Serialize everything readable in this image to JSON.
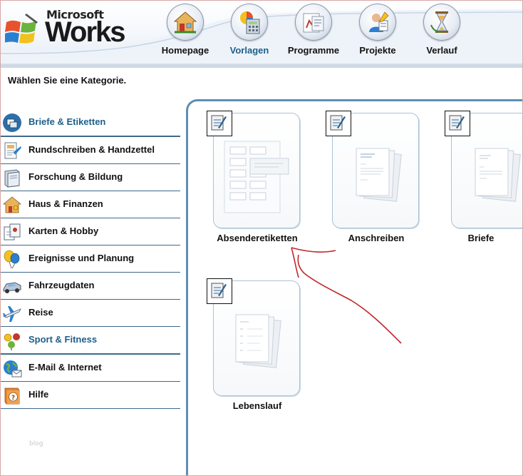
{
  "app": {
    "logo_brand": "Microsoft",
    "logo_name": "Works"
  },
  "nav": [
    {
      "label": "Homepage",
      "icon": "house-icon",
      "active": false
    },
    {
      "label": "Vorlagen",
      "icon": "templates-icon",
      "active": true
    },
    {
      "label": "Programme",
      "icon": "programs-icon",
      "active": false
    },
    {
      "label": "Projekte",
      "icon": "projects-icon",
      "active": false
    },
    {
      "label": "Verlauf",
      "icon": "history-icon",
      "active": false
    }
  ],
  "prompt": "Wählen Sie eine Kategorie.",
  "categories": [
    {
      "label": "Briefe & Etiketten",
      "icon": "letters-icon",
      "selected": true
    },
    {
      "label": "Rundschreiben & Handzettel",
      "icon": "newsletter-icon"
    },
    {
      "label": "Forschung & Bildung",
      "icon": "book-icon"
    },
    {
      "label": "Haus & Finanzen",
      "icon": "house-finance-icon"
    },
    {
      "label": "Karten & Hobby",
      "icon": "cards-icon"
    },
    {
      "label": "Ereignisse und Planung",
      "icon": "balloons-icon"
    },
    {
      "label": "Fahrzeugdaten",
      "icon": "car-icon"
    },
    {
      "label": "Reise",
      "icon": "airplane-icon"
    },
    {
      "label": "Sport & Fitness",
      "icon": "sport-icon",
      "highlighted": true
    },
    {
      "label": "E-Mail & Internet",
      "icon": "globe-icon"
    },
    {
      "label": "Hilfe",
      "icon": "help-icon"
    }
  ],
  "templates": [
    {
      "label": "Absenderetiketten",
      "preview": "labels"
    },
    {
      "label": "Anschreiben",
      "preview": "letter"
    },
    {
      "label": "Briefe",
      "preview": "letter"
    },
    {
      "label": "Lebenslauf",
      "preview": "resume"
    }
  ],
  "watermark": "blog",
  "colors": {
    "accent": "#1d5f8a",
    "panel_border": "#5d8fb3",
    "annotation": "#c0262b"
  }
}
